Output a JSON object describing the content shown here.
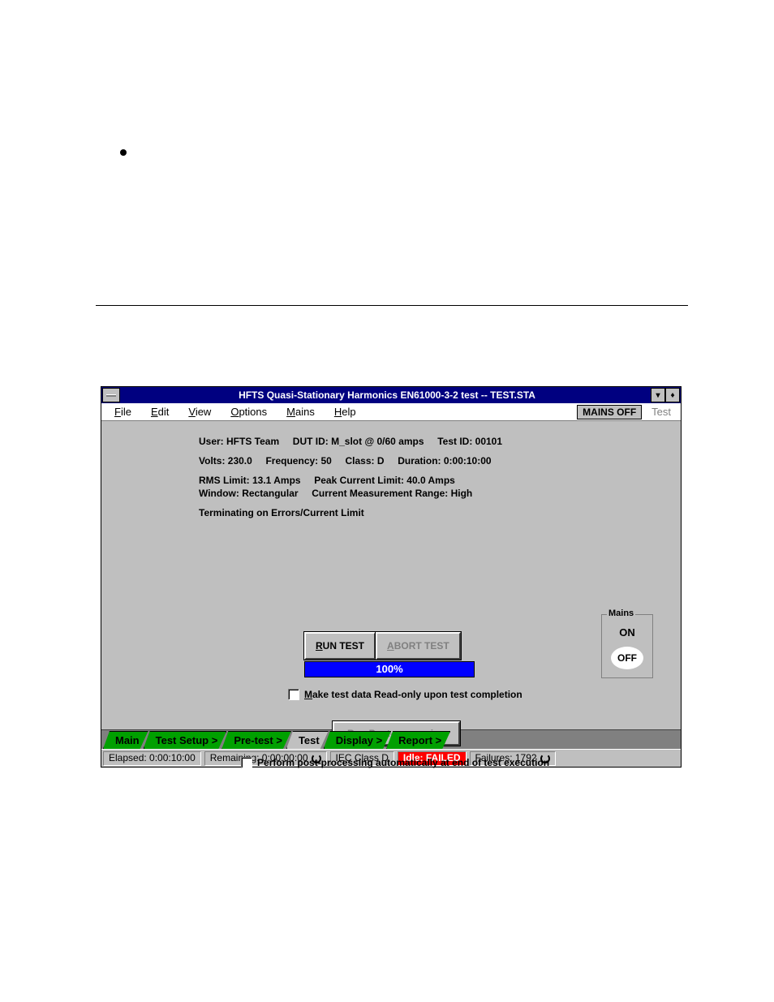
{
  "title": "HFTS Quasi-Stationary Harmonics EN61000-3-2 test -- TEST.STA",
  "menu": {
    "file": "File",
    "edit": "Edit",
    "view": "View",
    "options": "Options",
    "mains": "Mains",
    "help": "Help",
    "mains_off": "MAINS OFF",
    "tab_ind": "Test"
  },
  "info": {
    "line1": "User: HFTS Team     DUT ID: M_slot @ 0/60 amps     Test ID: 00101",
    "line2": "Volts: 230.0     Frequency: 50     Class: D     Duration: 0:00:10:00",
    "line3": "RMS Limit: 13.1 Amps     Peak Current Limit: 40.0 Amps",
    "line4": "Window: Rectangular     Current Measurement Range: High",
    "line5": "Terminating on Errors/Current Limit"
  },
  "buttons": {
    "run": "RUN TEST",
    "abort": "ABORT TEST",
    "post": "Run Post-processing"
  },
  "progress": "100%",
  "mains": {
    "legend": "Mains",
    "on": "ON",
    "off": "OFF"
  },
  "checks": {
    "readonly": "Make test data Read-only upon test completion",
    "autopost": "Perform post-processing automatically at end of test execution"
  },
  "tabs": {
    "main": "Main",
    "setup": "Test Setup >",
    "pretest": "Pre-test >",
    "test": "Test",
    "display": "Display >",
    "report": "Report >"
  },
  "status": {
    "elapsed": "Elapsed: 0:00:10:00",
    "remaining": "Remaining: 0:00:00:00",
    "class": "IEC Class D",
    "idle": "Idle: FAILED",
    "failures": "Failures: 1792"
  }
}
